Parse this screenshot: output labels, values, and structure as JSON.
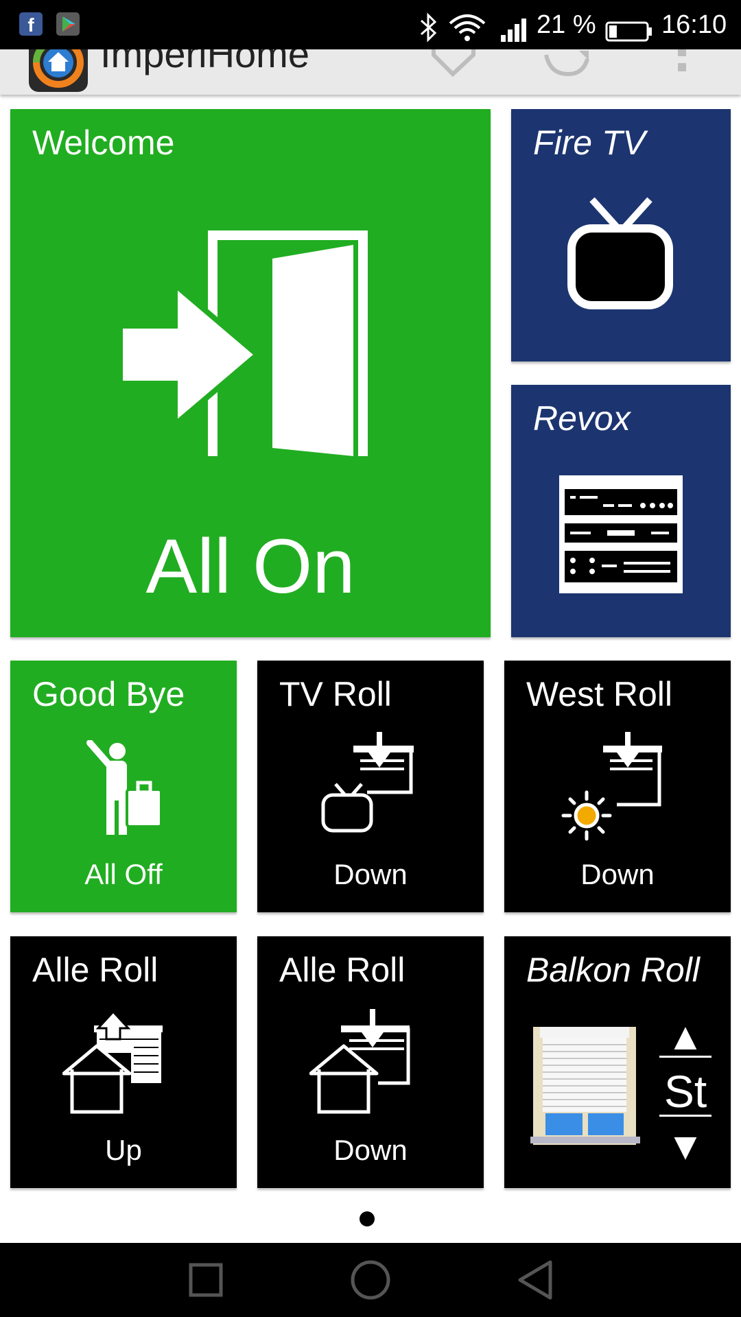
{
  "status_bar": {
    "battery_percent": "21 %",
    "time": "16:10",
    "battery_level": 0.21,
    "notification_icons": [
      "facebook-icon",
      "play-store-icon"
    ],
    "system_icons": [
      "bluetooth-icon",
      "wifi-icon",
      "signal-icon",
      "battery-icon"
    ]
  },
  "app_bar": {
    "title": "ImperiHome",
    "actions": [
      "tag-icon",
      "refresh-icon",
      "overflow-menu-icon"
    ]
  },
  "colors": {
    "green": "#21ad21",
    "navy": "#1c3570",
    "black": "#000000",
    "sun": "#f2a900"
  },
  "tiles": {
    "welcome": {
      "title": "Welcome",
      "action": "All On",
      "icon": "door-enter-icon"
    },
    "fire_tv": {
      "title": "Fire TV",
      "icon": "tv-icon"
    },
    "revox": {
      "title": "Revox",
      "icon": "hifi-rack-icon"
    },
    "good_bye": {
      "title": "Good Bye",
      "action": "All Off",
      "icon": "person-leaving-icon"
    },
    "tv_roll": {
      "title": "TV Roll",
      "action": "Down",
      "icon": "tv-shutter-down-icon"
    },
    "west_roll": {
      "title": "West Roll",
      "action": "Down",
      "icon": "sun-shutter-down-icon"
    },
    "alle_roll_up": {
      "title": "Alle Roll",
      "action": "Up",
      "icon": "house-shutter-up-icon"
    },
    "alle_roll_down": {
      "title": "Alle Roll",
      "action": "Down",
      "icon": "house-shutter-down-icon"
    },
    "balkon_roll": {
      "title": "Balkon Roll",
      "stop_label": "St",
      "up_symbol": "▲",
      "down_symbol": "▼",
      "icon": "window-shutter-icon"
    }
  },
  "pager": {
    "pages": 1,
    "current": 1
  },
  "nav_bar": {
    "buttons": [
      "recents-button",
      "home-button",
      "back-button"
    ]
  }
}
